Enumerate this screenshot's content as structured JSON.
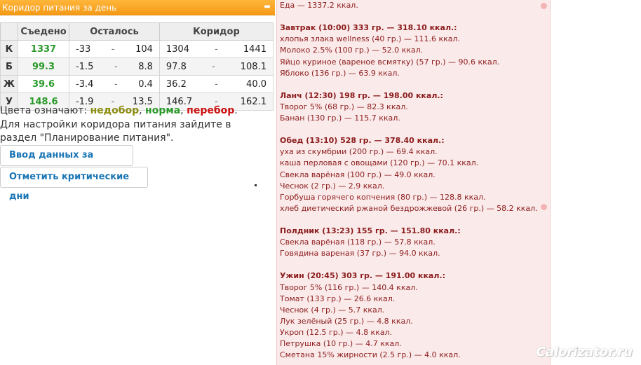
{
  "panel": {
    "title": "Коридор питания за день",
    "collapse_icon": "minus-icon"
  },
  "table": {
    "headers": [
      "Съедено",
      "Осталось",
      "Коридор"
    ],
    "rows": [
      {
        "label": "К",
        "eaten": "1337",
        "left_min": "-33",
        "left_max": "104",
        "cor_min": "1304",
        "cor_max": "1441"
      },
      {
        "label": "Б",
        "eaten": "99.3",
        "left_min": "-1.5",
        "left_max": "8.8",
        "cor_min": "97.8",
        "cor_max": "108.1"
      },
      {
        "label": "Ж",
        "eaten": "39.6",
        "left_min": "-3.4",
        "left_max": "0.4",
        "cor_min": "36.2",
        "cor_max": "40.0"
      },
      {
        "label": "У",
        "eaten": "148.6",
        "left_min": "-1.9",
        "left_max": "13.5",
        "cor_min": "146.7",
        "cor_max": "162.1"
      }
    ],
    "dash": "-"
  },
  "legend": {
    "prefix": "Цвета означают: ",
    "under": "недобор",
    "sep1": ", ",
    "norm": "норма",
    "sep2": ", ",
    "over": "перебор",
    "suffix": "."
  },
  "hint": "Для настройки коридора питания зайдите в раздел \"Планирование питания\".",
  "buttons": {
    "enter": "Ввод данных за сегодня",
    "critical": "Отметить критические дни"
  },
  "colors": {
    "header": "#f7a21f",
    "under": "#8c8c10",
    "norm": "#2a9a2a",
    "over": "#cc1111",
    "diary_bg": "#fbeaea",
    "diary_text": "#8b1c1c"
  },
  "diary": [
    {
      "text": "Еда — 1337.2 ккал.",
      "meal": false
    },
    {
      "text": "",
      "meal": false
    },
    {
      "text": "Завтрак (10:00) 333 гр. — 318.10 ккал.:",
      "meal": true
    },
    {
      "text": "хлопья злака wellness (40 гр.) — 111.6 ккал.",
      "meal": false
    },
    {
      "text": "Молоко 2.5% (100 гр.) — 52.0 ккал.",
      "meal": false
    },
    {
      "text": "Яйцо куриное (вареное всмятку) (57 гр.) — 90.6 ккал.",
      "meal": false
    },
    {
      "text": "Яблоко (136 гр.) — 63.9 ккал.",
      "meal": false
    },
    {
      "text": "",
      "meal": false
    },
    {
      "text": "Ланч (12:30) 198 гр. — 198.00 ккал.:",
      "meal": true
    },
    {
      "text": "Творог 5% (68 гр.) — 82.3 ккал.",
      "meal": false
    },
    {
      "text": "Банан (130 гр.) — 115.7 ккал.",
      "meal": false
    },
    {
      "text": "",
      "meal": false
    },
    {
      "text": "Обед (13:10) 528 гр. — 378.40 ккал.:",
      "meal": true
    },
    {
      "text": "уха из скумбрии (200 гр.) — 69.4 ккал.",
      "meal": false
    },
    {
      "text": "каша перловая с овощами (120 гр.) — 70.1 ккал.",
      "meal": false
    },
    {
      "text": "Свекла варёная (100 гр.) — 49.0 ккал.",
      "meal": false
    },
    {
      "text": "Чеснок (2 гр.) — 2.9 ккал.",
      "meal": false
    },
    {
      "text": "Горбуша горячего копчения (80 гр.) — 128.8 ккал.",
      "meal": false
    },
    {
      "text": "хлеб диетический ржаной бездрожжевой (26 гр.) — 58.2 ккал.",
      "meal": false
    },
    {
      "text": "",
      "meal": false
    },
    {
      "text": "Полдник (13:23) 155 гр. — 151.80 ккал.:",
      "meal": true
    },
    {
      "text": "Свекла варёная (118 гр.) — 57.8 ккал.",
      "meal": false
    },
    {
      "text": "Говядина вареная (37 гр.) — 94.0 ккал.",
      "meal": false
    },
    {
      "text": "",
      "meal": false
    },
    {
      "text": "Ужин (20:45) 303 гр. — 191.00 ккал.:",
      "meal": true
    },
    {
      "text": "Творог 5% (116 гр.) — 140.4 ккал.",
      "meal": false
    },
    {
      "text": "Томат (133 гр.) — 26.6 ккал.",
      "meal": false
    },
    {
      "text": "Чеснок (4 гр.) — 5.7 ккал.",
      "meal": false
    },
    {
      "text": "Лук зелёный (25 гр.) — 4.8 ккал.",
      "meal": false
    },
    {
      "text": "Укроп (12.5 гр.) — 4.8 ккал.",
      "meal": false
    },
    {
      "text": "Петрушка (10 гр.) — 4.7 ккал.",
      "meal": false
    },
    {
      "text": "Сметана 15% жирности (2.5 гр.) — 4.0 ккал.",
      "meal": false
    }
  ],
  "watermark": "Calorizator.ru"
}
